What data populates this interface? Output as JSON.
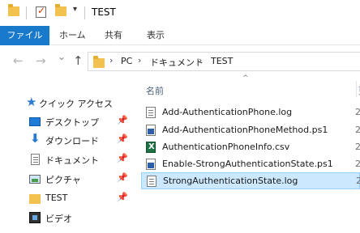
{
  "window": {
    "title": "TEST",
    "dropdown_glyph": "▾"
  },
  "ribbon": {
    "tabs": [
      {
        "label": "ファイル"
      },
      {
        "label": "ホーム"
      },
      {
        "label": "共有"
      },
      {
        "label": "表示"
      }
    ]
  },
  "navigation": {
    "back_glyph": "←",
    "forward_glyph": "→",
    "recent_glyph": "⌄",
    "up_glyph": "↑",
    "breadcrumb": [
      {
        "label": "PC"
      },
      {
        "label": "ドキュメント"
      },
      {
        "label": "TEST"
      }
    ],
    "separator": "›"
  },
  "sidebar": {
    "quick_access": "クイック アクセス",
    "items": [
      {
        "label": "デスクトップ",
        "icon": "desktop-icon",
        "pinned": true
      },
      {
        "label": "ダウンロード",
        "icon": "download-icon",
        "pinned": true
      },
      {
        "label": "ドキュメント",
        "icon": "documents-icon",
        "pinned": true
      },
      {
        "label": "ピクチャ",
        "icon": "pictures-icon",
        "pinned": true
      },
      {
        "label": "TEST",
        "icon": "folder-icon",
        "pinned": true
      },
      {
        "label": "ビデオ",
        "icon": "videos-icon",
        "pinned": false
      }
    ],
    "pin_glyph": "📌"
  },
  "file_list": {
    "column_name": "名前",
    "column_next": "更",
    "sort_glyph": "^",
    "files": [
      {
        "name": "Add-AuthenticationPhone.log",
        "type": "log",
        "date": "2",
        "selected": false
      },
      {
        "name": "Add-AuthenticationPhoneMethod.ps1",
        "type": "ps1",
        "date": "2",
        "selected": false
      },
      {
        "name": "AuthenticationPhoneInfo.csv",
        "type": "csv",
        "date": "2",
        "selected": false
      },
      {
        "name": "Enable-StrongAuthenticationState.ps1",
        "type": "ps1",
        "date": "2",
        "selected": false
      },
      {
        "name": "StrongAuthenticationState.log",
        "type": "log",
        "date": "2",
        "selected": true
      }
    ]
  },
  "colors": {
    "file_tab": "#1979ca",
    "selection": "#cce8ff",
    "selection_border": "#99d1ff",
    "folder": "#f2c14e"
  }
}
